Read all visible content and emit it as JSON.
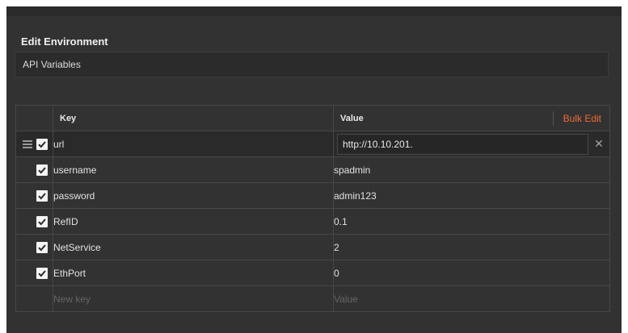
{
  "header": {
    "title": "Edit Environment"
  },
  "environment": {
    "name": "API Variables"
  },
  "table": {
    "col_key": "Key",
    "col_value": "Value",
    "bulk_edit_label": "Bulk Edit",
    "rows": [
      {
        "key": "url",
        "value": "http://10.10.201.",
        "checked": true
      },
      {
        "key": "username",
        "value": "spadmin",
        "checked": true
      },
      {
        "key": "password",
        "value": "admin123",
        "checked": true
      },
      {
        "key": "RefID",
        "value": "0.1",
        "checked": true
      },
      {
        "key": "NetService",
        "value": "2",
        "checked": true
      },
      {
        "key": "EthPort",
        "value": "0",
        "checked": true
      }
    ],
    "new_row": {
      "key_placeholder": "New key",
      "value_placeholder": "Value"
    }
  },
  "icons": {
    "drag": "drag-handle-icon",
    "check": "checkbox-checked-icon",
    "close": "close-icon"
  },
  "colors": {
    "accent": "#f06a35",
    "panel": "#323232"
  }
}
